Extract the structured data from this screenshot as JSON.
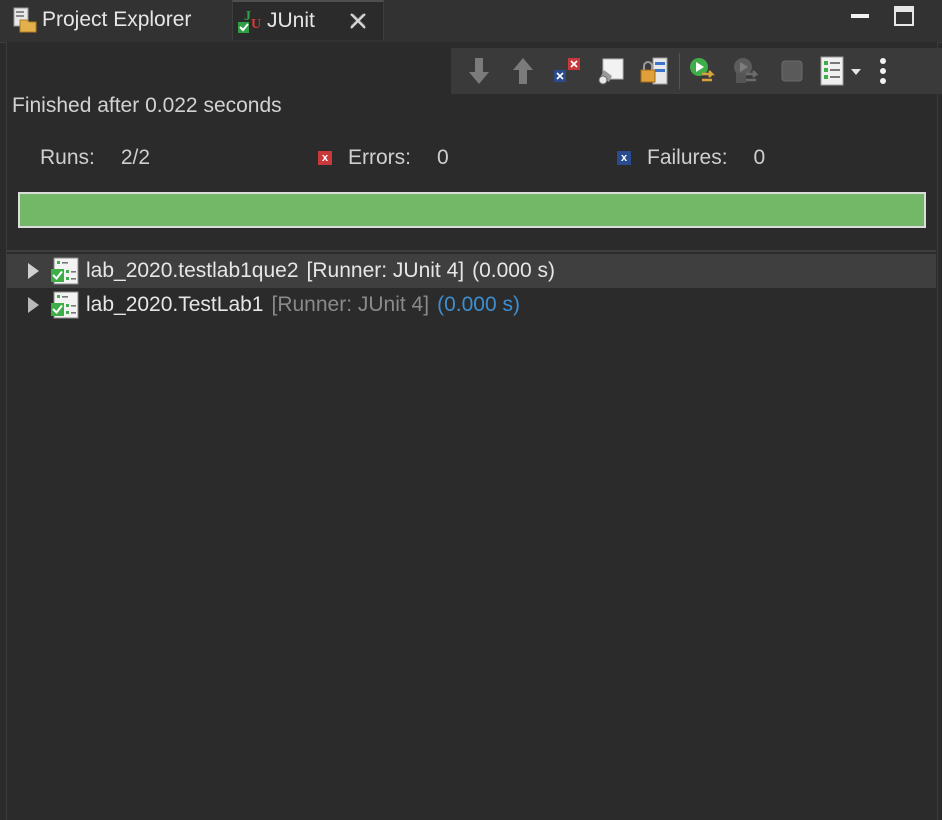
{
  "tabs": {
    "project_explorer": "Project Explorer",
    "junit": "JUnit"
  },
  "status": {
    "finished_text": "Finished after 0.022 seconds"
  },
  "counters": {
    "runs_label": "Runs:",
    "runs_value": "2/2",
    "errors_label": "Errors:",
    "errors_value": "0",
    "failures_label": "Failures:",
    "failures_value": "0"
  },
  "progress": {
    "fraction": 1.0,
    "color": "#73b866"
  },
  "toolbar": {
    "icons": [
      "next-failure-icon",
      "previous-failure-icon",
      "show-failures-only-icon",
      "show-skipped-tests-icon",
      "scroll-lock-icon",
      "rerun-test-icon",
      "rerun-failed-first-icon",
      "stop-icon",
      "test-run-history-icon",
      "view-menu-icon"
    ]
  },
  "tree": {
    "rows": [
      {
        "name": "lab_2020.testlab1que2",
        "runner": "[Runner: JUnit 4]",
        "time": "(0.000 s)",
        "selected": true
      },
      {
        "name": "lab_2020.TestLab1",
        "runner": "[Runner: JUnit 4]",
        "time": "(0.000 s)",
        "selected": false
      }
    ]
  },
  "colors": {
    "background": "#2b2b2b",
    "error_red": "#c9383b",
    "failure_blue": "#2a4c8f",
    "time_blue": "#3d8fd1"
  }
}
